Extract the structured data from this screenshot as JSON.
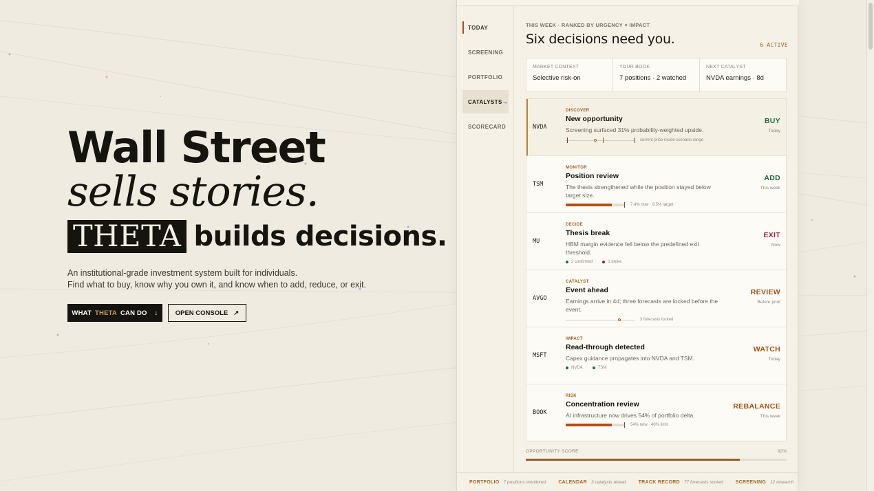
{
  "hero": {
    "line1": "Wall Street",
    "line2": "sells stories.",
    "theta": "THETA",
    "line3_rest": "builds decisions.",
    "sub1": "An institutional-grade investment system built for individuals.",
    "sub2": "Find what to buy, know why you own it, and know when to add, reduce, or exit.",
    "btn_primary_pre": "WHAT",
    "btn_primary_theta": "THETA",
    "btn_primary_post": "CAN DO",
    "btn_primary_icon": "↓",
    "btn_secondary": "OPEN CONSOLE",
    "btn_secondary_icon": "↗"
  },
  "nav": {
    "items": [
      {
        "label": "TODAY"
      },
      {
        "label": "SCREENING"
      },
      {
        "label": "PORTFOLIO"
      },
      {
        "label": "CATALYSTS",
        "arrow": "→"
      },
      {
        "label": "SCORECARD"
      }
    ]
  },
  "main": {
    "eyebrow": "THIS WEEK · RANKED BY URGENCY × IMPACT",
    "headline": "Six decisions need you.",
    "active": "6 ACTIVE"
  },
  "context": [
    {
      "label": "MARKET CONTEXT",
      "value": "Selective risk-on"
    },
    {
      "label": "YOUR BOOK",
      "value": "7 positions · 2 watched"
    },
    {
      "label": "NEXT CATALYST",
      "value": "NVDA earnings · 8d"
    }
  ],
  "cards": [
    {
      "ticker": "NVDA",
      "type": "DISCOVER",
      "title": "New opportunity",
      "desc": "Screening surfaced 31% probability-weighted upside.",
      "viz_note": "current price inside scenario range",
      "action": "BUY",
      "when": "Today"
    },
    {
      "ticker": "TSM",
      "type": "MONITOR",
      "title": "Position review",
      "desc": "The thesis strengthened while the position stayed below target size.",
      "viz_note": "7.4% now · 9.5% target",
      "progress": 0.78,
      "action": "ADD",
      "when": "This week"
    },
    {
      "ticker": "MU",
      "type": "DECIDE",
      "title": "Thesis break",
      "desc": "HBM margin evidence fell below the predefined exit threshold.",
      "legend": [
        "2 confirmed",
        "1 broke"
      ],
      "action": "EXIT",
      "when": "Now"
    },
    {
      "ticker": "AVGO",
      "type": "CATALYST",
      "title": "Event ahead",
      "desc": "Earnings arrive in 4d; three forecasts are locked before the event.",
      "viz_note": "3 forecasts locked",
      "action": "REVIEW",
      "when": "Before print"
    },
    {
      "ticker": "MSFT",
      "type": "IMPACT",
      "title": "Read-through detected",
      "desc": "Capex guidance propagates into NVDA and TSM.",
      "legend": [
        "NVDA",
        "TSM"
      ],
      "action": "WATCH",
      "when": "Today"
    },
    {
      "ticker": "BOOK",
      "type": "RISK",
      "title": "Concentration review",
      "desc": "AI infrastructure now drives 54% of portfolio delta.",
      "viz_note": "54% now · 40% limit",
      "progress": 0.78,
      "action": "REBALANCE",
      "when": "This week"
    }
  ],
  "opportunity": {
    "label": "OPPORTUNITY SCORE",
    "value": "82%",
    "fraction": 0.82
  },
  "footer": [
    {
      "label": "PORTFOLIO",
      "sub": "7 positions monitored"
    },
    {
      "label": "CALENDAR",
      "sub": "3 catalysts ahead"
    },
    {
      "label": "TRACK RECORD",
      "sub": "77 forecasts scored"
    },
    {
      "label": "SCREENING",
      "sub": "12 research"
    }
  ],
  "colors": {
    "accent": "#b54d14",
    "buy": "#1e6a3a",
    "exit": "#a01f40",
    "review": "#a3520f"
  }
}
